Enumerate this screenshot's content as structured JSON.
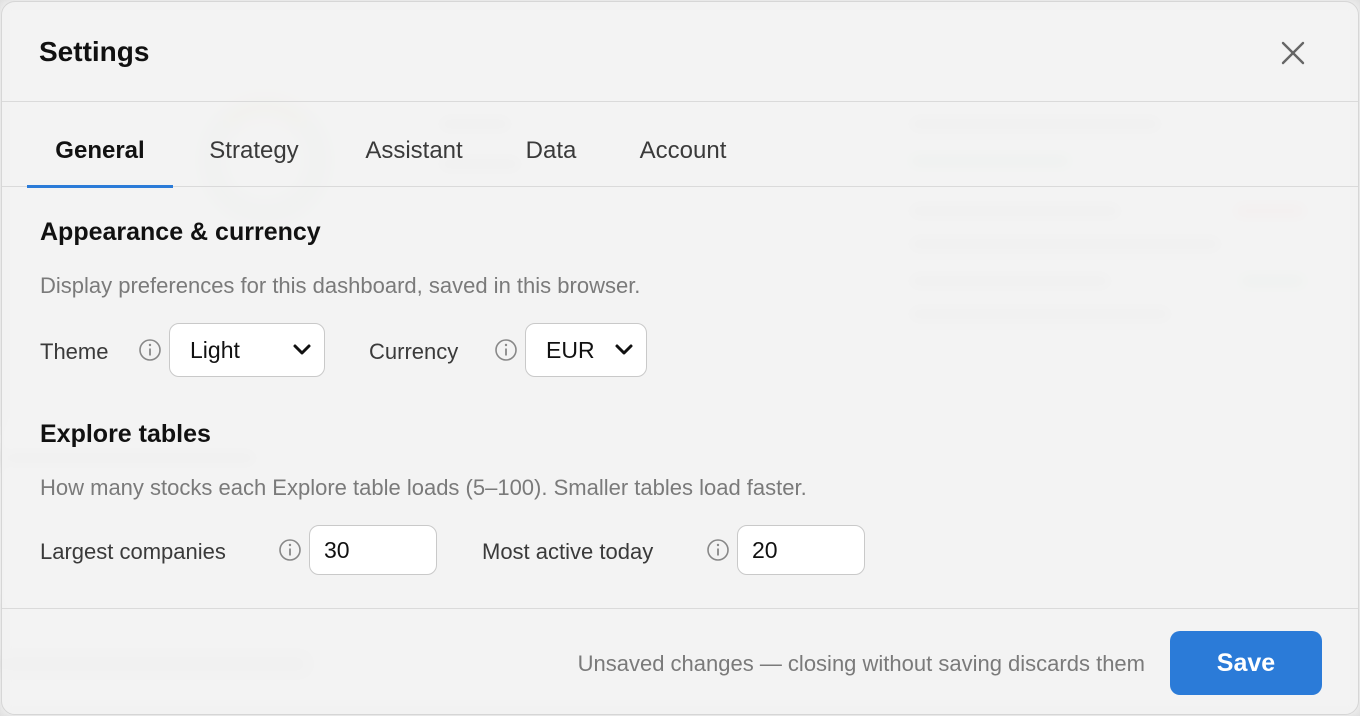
{
  "dialog": {
    "title": "Settings"
  },
  "tabs": [
    {
      "label": "General",
      "active": true
    },
    {
      "label": "Strategy",
      "active": false
    },
    {
      "label": "Assistant",
      "active": false
    },
    {
      "label": "Data",
      "active": false
    },
    {
      "label": "Account",
      "active": false
    }
  ],
  "appearance": {
    "title": "Appearance & currency",
    "description": "Display preferences for this dashboard, saved in this browser.",
    "theme_label": "Theme",
    "theme_value": "Light",
    "currency_label": "Currency",
    "currency_value": "EUR"
  },
  "explore": {
    "title": "Explore tables",
    "description": "How many stocks each Explore table loads (5–100). Smaller tables load faster.",
    "largest_label": "Largest companies",
    "largest_value": "30",
    "active_label": "Most active today",
    "active_value": "20"
  },
  "footer": {
    "note": "Unsaved changes — closing without saving discards them",
    "save_label": "Save"
  },
  "colors": {
    "accent": "#2b7bd8",
    "muted_text": "#7a7a7a"
  },
  "icons": {
    "close": "close-icon",
    "info": "info-icon",
    "dropdown": "chevron-down-icon"
  }
}
